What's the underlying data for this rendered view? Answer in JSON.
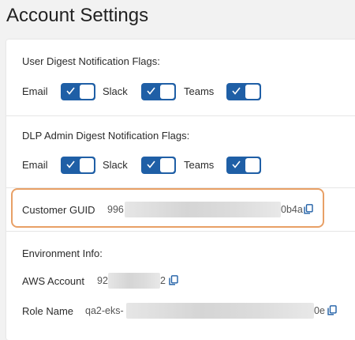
{
  "page": {
    "title": "Account Settings"
  },
  "user_digest": {
    "heading": "User Digest Notification Flags:",
    "flags": [
      {
        "label": "Email",
        "enabled": true
      },
      {
        "label": "Slack",
        "enabled": true
      },
      {
        "label": "Teams",
        "enabled": true
      }
    ]
  },
  "dlp_digest": {
    "heading": "DLP Admin Digest Notification Flags:",
    "flags": [
      {
        "label": "Email",
        "enabled": true
      },
      {
        "label": "Slack",
        "enabled": true
      },
      {
        "label": "Teams",
        "enabled": true
      }
    ]
  },
  "customer": {
    "label": "Customer GUID",
    "value_prefix": "996",
    "value_suffix": "0b4a"
  },
  "environment": {
    "heading": "Environment Info:",
    "aws_label": "AWS Account",
    "aws_prefix": "92",
    "aws_suffix": "2",
    "role_label": "Role Name",
    "role_prefix": "qa2-eks-",
    "role_suffix": "0e"
  },
  "colors": {
    "toggle_on": "#1f5fa6",
    "highlight_border": "#e8a066",
    "copy_icon": "#1f5fa6"
  },
  "icons": {
    "toggle_check": "check-icon",
    "copy": "copy-icon"
  }
}
